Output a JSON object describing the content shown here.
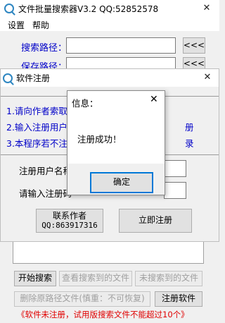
{
  "main_window": {
    "title": "文件批量搜索器V3.2 QQ:52852578",
    "menu": [
      "设置",
      "帮助"
    ],
    "search_path_label": "搜索路径：",
    "save_path_label": "保存路径：",
    "browse_label": "<<<",
    "buttons": {
      "start_search": "开始搜索",
      "view_found": "查看搜索到的文件",
      "not_found": "未搜索到的文件",
      "delete_source": "删除原路径文件(慎重：不可恢复)",
      "register": "注册软件"
    },
    "status_text": "《软件未注册，试用版搜索文件不能超过10个》"
  },
  "register_window": {
    "title": "软件注册",
    "info_lines": [
      "1.请向作者索取注",
      "2.输入注册用户名",
      "3.本程序若不注册"
    ],
    "info_right": [
      "册",
      "录"
    ],
    "username_label": "注册用户名称",
    "code_label": "请输入注册码",
    "contact_button_line1": "联系作者",
    "contact_button_line2": "QQ:863917316",
    "register_now_button": "立即注册"
  },
  "message_box": {
    "title": "信息：",
    "message": "注册成功！",
    "ok_button": "确定"
  },
  "colors": {
    "info_text": "#0000c8",
    "status_text": "#e00000",
    "icon_accent": "#2e86c1"
  }
}
